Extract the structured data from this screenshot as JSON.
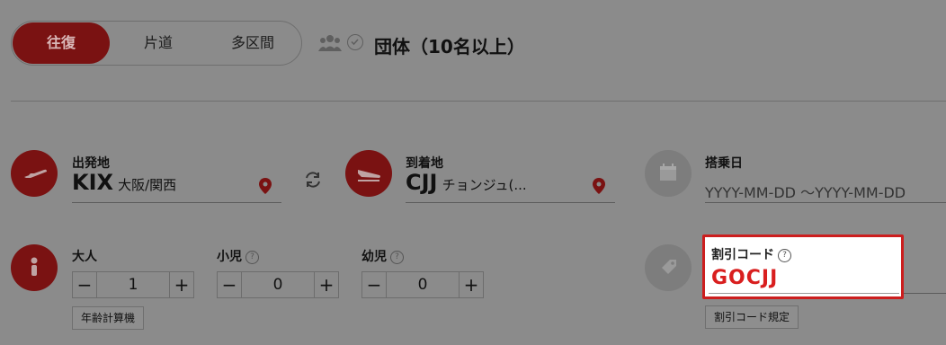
{
  "trip_type": {
    "options": [
      "往復",
      "片道",
      "多区間"
    ],
    "selected": "往復"
  },
  "group": {
    "icon": "group-users-icon",
    "label": "団体（10名以上）"
  },
  "departure": {
    "label": "出発地",
    "code": "KIX",
    "city": "大阪/関西",
    "icon": "plane-takeoff-icon"
  },
  "swap_icon": "swap-icon",
  "arrival": {
    "label": "到着地",
    "code": "CJJ",
    "city": "チョンジュ(...",
    "icon": "plane-landing-icon"
  },
  "boarding_date": {
    "label": "搭乗日",
    "start_placeholder": "YYYY-MM-DD",
    "separator": "～",
    "end_placeholder": "YYYY-MM-DD",
    "icon": "calendar-icon"
  },
  "passengers": {
    "icon": "person-icon",
    "adult": {
      "label": "大人",
      "value": "1"
    },
    "child": {
      "label": "小児",
      "value": "0"
    },
    "infant": {
      "label": "幼児",
      "value": "0"
    },
    "minus": "−",
    "plus": "+",
    "help": "?",
    "age_calc_button": "年齢計算機"
  },
  "promo": {
    "label": "割引コード",
    "help": "?",
    "value": "GOCJJ",
    "rules_button": "割引コード規定",
    "icon": "tag-icon",
    "highlight_color": "#cc1e1e"
  }
}
